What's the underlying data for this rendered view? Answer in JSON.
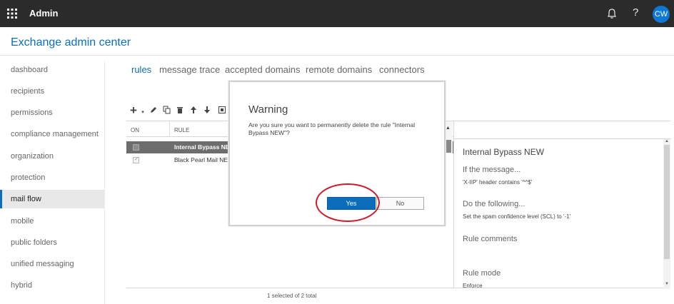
{
  "topbar": {
    "app_name": "Admin",
    "avatar_initials": "CW",
    "help_label": "?"
  },
  "header": {
    "title": "Exchange admin center"
  },
  "nav": {
    "items": [
      {
        "label": "dashboard"
      },
      {
        "label": "recipients"
      },
      {
        "label": "permissions"
      },
      {
        "label": "compliance management"
      },
      {
        "label": "organization"
      },
      {
        "label": "protection"
      },
      {
        "label": "mail flow",
        "active": true
      },
      {
        "label": "mobile"
      },
      {
        "label": "public folders"
      },
      {
        "label": "unified messaging"
      },
      {
        "label": "hybrid"
      }
    ]
  },
  "tabs": [
    {
      "label": "rules",
      "active": true
    },
    {
      "label": "message trace"
    },
    {
      "label": "accepted domains"
    },
    {
      "label": "remote domains"
    },
    {
      "label": "connectors"
    }
  ],
  "toolbar": {
    "icons": [
      "add-icon",
      "edit-icon",
      "copy-icon",
      "delete-icon",
      "move-up-icon",
      "move-down-icon",
      "report-icon"
    ]
  },
  "grid": {
    "columns": [
      "ON",
      "RULE"
    ],
    "rows": [
      {
        "name": "Internal Bypass NEW",
        "selected": true
      },
      {
        "name": "Black Pearl Mail NEW",
        "selected": false
      }
    ],
    "status": "1 selected of 2 total"
  },
  "details": {
    "title": "Internal Bypass NEW",
    "if_label": "If the message...",
    "if_text": "'X-IIP' header contains '^^$'",
    "do_label": "Do the following...",
    "do_text": "Set the spam confidence level (SCL) to '-1'",
    "comments_label": "Rule comments",
    "mode_label": "Rule mode",
    "mode_value": "Enforce"
  },
  "dialog": {
    "title": "Warning",
    "message": "Are you sure you want to permanently delete the rule \"Internal Bypass NEW\"?",
    "yes_label": "Yes",
    "no_label": "No"
  },
  "colors": {
    "accent": "#0a6ebd",
    "highlight": "#d11a2a"
  }
}
